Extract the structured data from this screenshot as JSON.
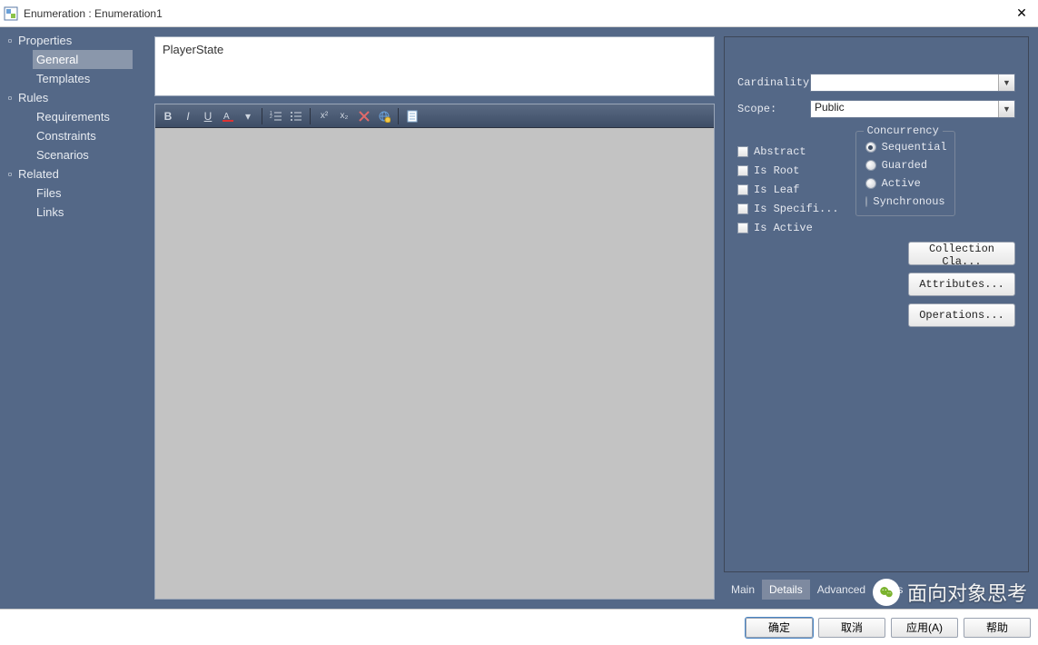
{
  "title": "Enumeration : Enumeration1",
  "sidebar": {
    "groups": [
      {
        "label": "Properties",
        "items": [
          {
            "label": "General",
            "selected": true
          },
          {
            "label": "Templates"
          }
        ]
      },
      {
        "label": "Rules",
        "items": [
          {
            "label": "Requirements"
          },
          {
            "label": "Constraints"
          },
          {
            "label": "Scenarios"
          }
        ]
      },
      {
        "label": "Related",
        "items": [
          {
            "label": "Files"
          },
          {
            "label": "Links"
          }
        ]
      }
    ]
  },
  "name_field": "PlayerState",
  "toolbar": {
    "bold": "B",
    "italic": "I",
    "underline": "U"
  },
  "panel": {
    "cardinality_label": "Cardinality:",
    "cardinality_value": "",
    "scope_label": "Scope:",
    "scope_value": "Public",
    "checks": [
      {
        "label": "Abstract"
      },
      {
        "label": "Is Root"
      },
      {
        "label": "Is Leaf"
      },
      {
        "label": "Is Specifi..."
      },
      {
        "label": "Is Active"
      }
    ],
    "concurrency_legend": "Concurrency",
    "radios": [
      {
        "label": "Sequential",
        "checked": true
      },
      {
        "label": "Guarded"
      },
      {
        "label": "Active"
      },
      {
        "label": "Synchronous"
      }
    ],
    "buttons": {
      "collection": "Collection Cla...",
      "attributes": "Attributes...",
      "operations": "Operations..."
    }
  },
  "tabs": [
    {
      "label": "Main"
    },
    {
      "label": "Details",
      "active": true
    },
    {
      "label": "Advanced"
    },
    {
      "label": "Tags"
    }
  ],
  "footer": {
    "ok": "确定",
    "cancel": "取消",
    "apply": "应用(A)",
    "help": "帮助"
  },
  "watermark_text": "面向对象思考"
}
